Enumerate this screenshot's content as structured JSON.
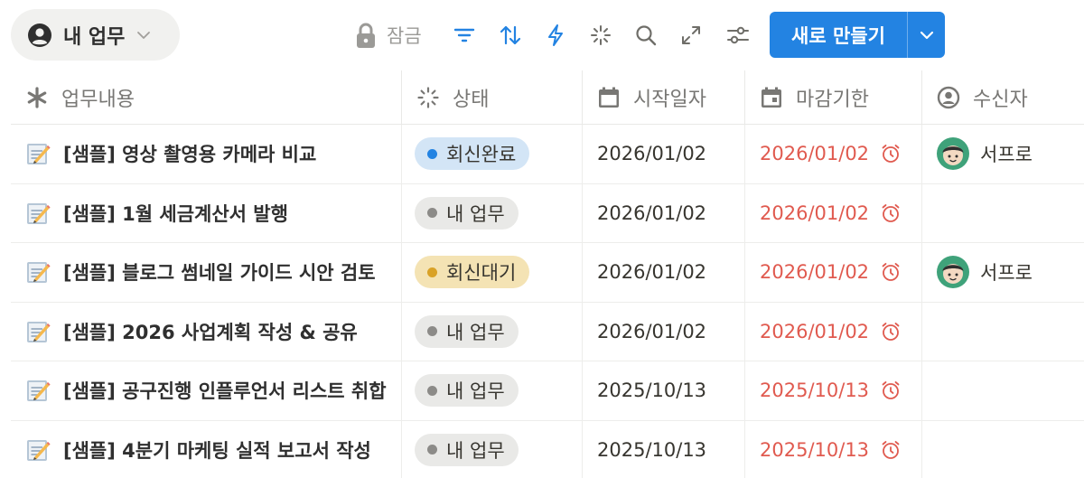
{
  "toolbar": {
    "view_label": "내 업무",
    "lock_label": "잠금",
    "new_button_label": "새로 만들기",
    "accent_color": "#2383e2"
  },
  "columns": [
    {
      "label": "업무내용",
      "icon": "asterisk-icon"
    },
    {
      "label": "상태",
      "icon": "loading-spinner-icon"
    },
    {
      "label": "시작일자",
      "icon": "calendar-icon"
    },
    {
      "label": "마감기한",
      "icon": "calendar-event-icon"
    },
    {
      "label": "수신자",
      "icon": "person-circle-icon"
    }
  ],
  "rows": [
    {
      "title": "[샘플] 영상 촬영용 카메라 비교",
      "status": "회신완료",
      "status_bg": "#d3e5f6",
      "status_dot": "#2383e2",
      "start": "2026/01/02",
      "due": "2026/01/02",
      "assignee": "서프로"
    },
    {
      "title": "[샘플] 1월 세금계산서 발행",
      "status": "내 업무",
      "status_bg": "#e9e9e7",
      "status_dot": "#8c8b88",
      "start": "2026/01/02",
      "due": "2026/01/02",
      "assignee": ""
    },
    {
      "title": "[샘플] 블로그 썸네일 가이드 시안 검토",
      "status": "회신대기",
      "status_bg": "#f4e3b4",
      "status_dot": "#d9a227",
      "start": "2026/01/02",
      "due": "2026/01/02",
      "assignee": "서프로"
    },
    {
      "title": "[샘플] 2026 사업계획 작성 & 공유",
      "status": "내 업무",
      "status_bg": "#e9e9e7",
      "status_dot": "#8c8b88",
      "start": "2026/01/02",
      "due": "2026/01/02",
      "assignee": ""
    },
    {
      "title": "[샘플] 공구진행 인플루언서 리스트 취합",
      "status": "내 업무",
      "status_bg": "#e9e9e7",
      "status_dot": "#8c8b88",
      "start": "2025/10/13",
      "due": "2025/10/13",
      "assignee": ""
    },
    {
      "title": "[샘플] 4분기 마케팅 실적 보고서 작성",
      "status": "내 업무",
      "status_bg": "#e9e9e7",
      "status_dot": "#8c8b88",
      "start": "2025/10/13",
      "due": "2025/10/13",
      "assignee": ""
    }
  ]
}
